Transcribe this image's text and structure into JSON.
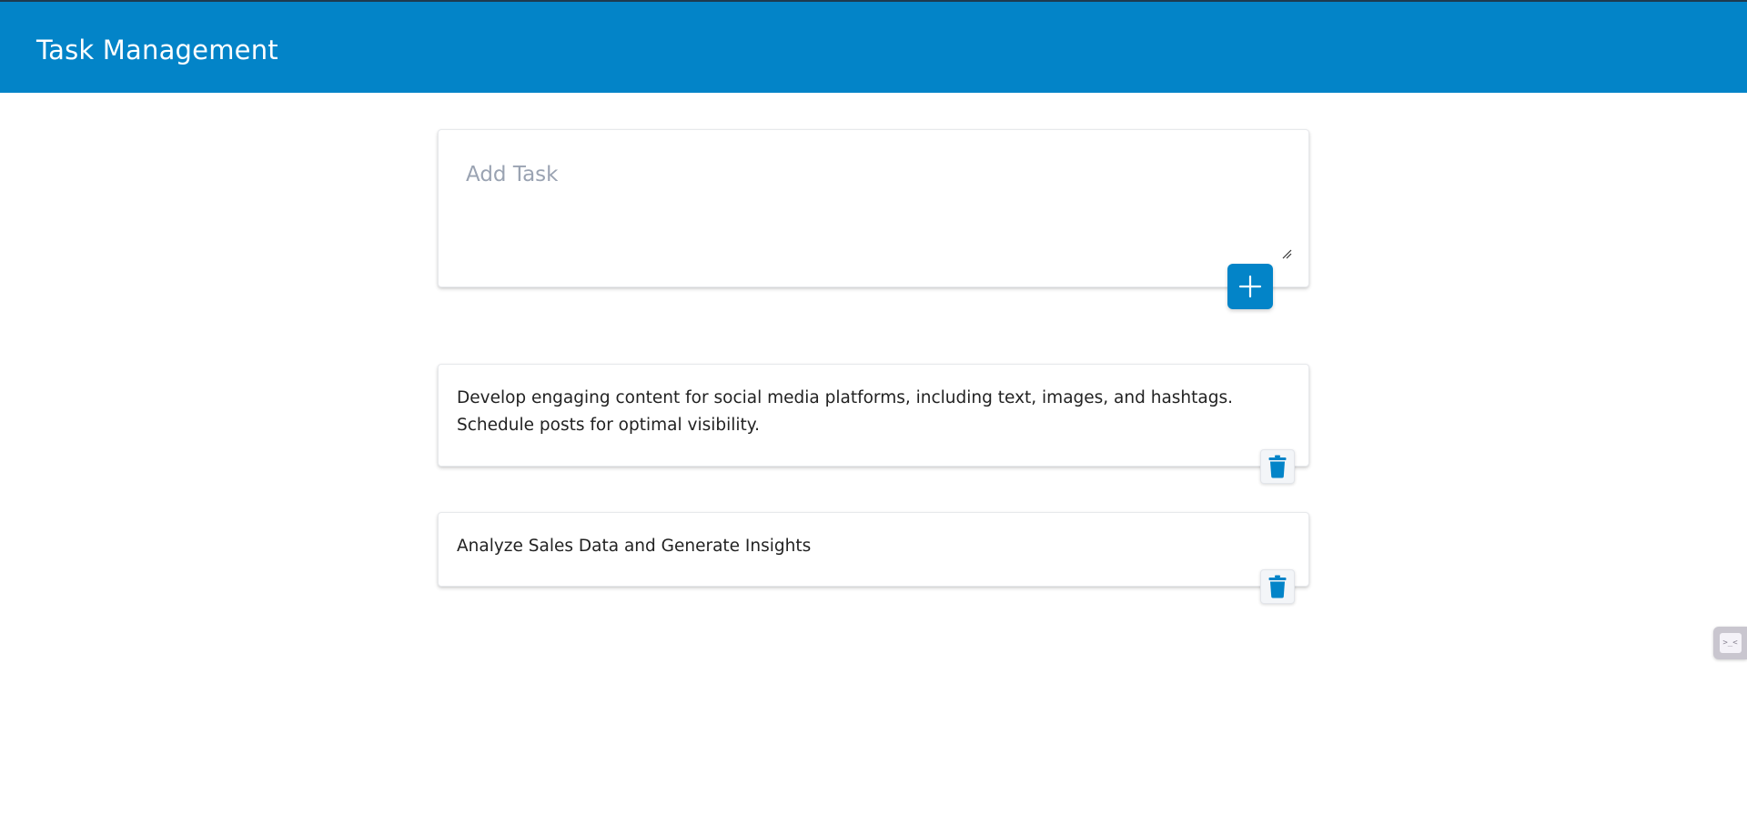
{
  "header": {
    "title": "Task Management"
  },
  "add_task": {
    "placeholder": "Add Task",
    "value": "",
    "add_button_icon": "plus-icon"
  },
  "tasks": [
    {
      "text": "Develop engaging content for social media platforms, including text, images, and hashtags. Schedule posts for optimal visibility.",
      "delete_icon": "trash-icon"
    },
    {
      "text": "Analyze Sales Data and Generate Insights",
      "delete_icon": "trash-icon"
    }
  ],
  "side_widget": {
    "icon": "terminal-icon",
    "glyph": ">_<"
  },
  "colors": {
    "primary": "#0384c8",
    "header_border": "#1e3a4f",
    "placeholder": "#9aa3b2",
    "text": "#222222"
  }
}
